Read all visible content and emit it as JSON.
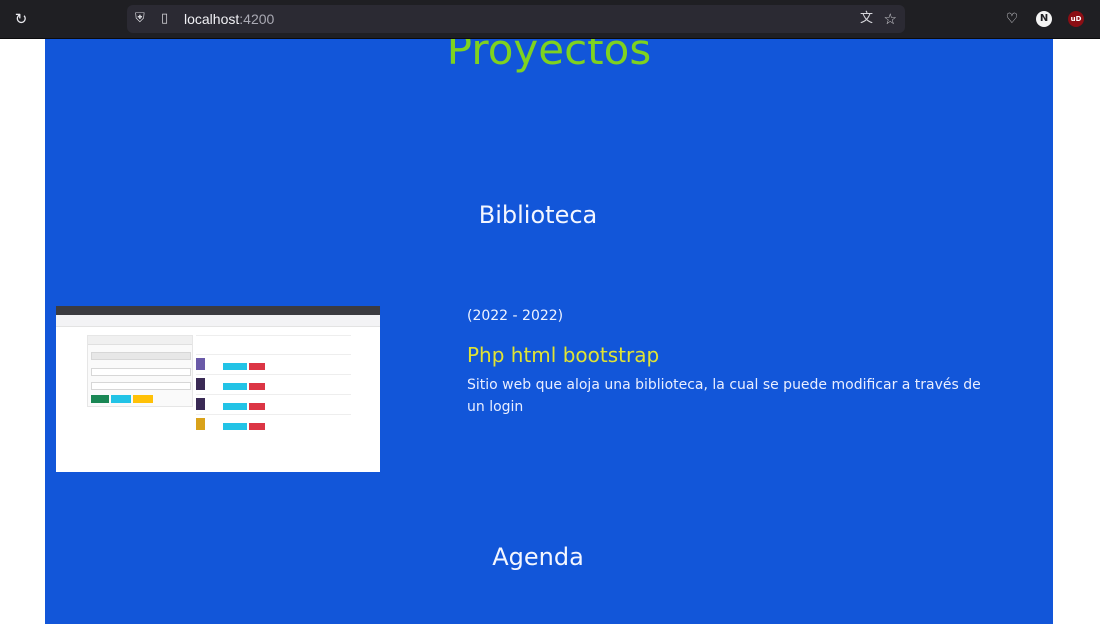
{
  "browser": {
    "url_host": "localhost",
    "url_port": ":4200"
  },
  "page": {
    "title": "Proyectos",
    "sections": [
      {
        "title": "Biblioteca",
        "years": "(2022 - 2022)",
        "project_name": "Php html bootstrap",
        "description": "Sitio web que aloja una biblioteca, la cual se puede modificar a través de un login"
      },
      {
        "title": "Agenda"
      }
    ]
  },
  "colors": {
    "background_blue": "#1256d9",
    "title_green": "#7fd21f",
    "project_name_yellow": "#e0e334"
  }
}
